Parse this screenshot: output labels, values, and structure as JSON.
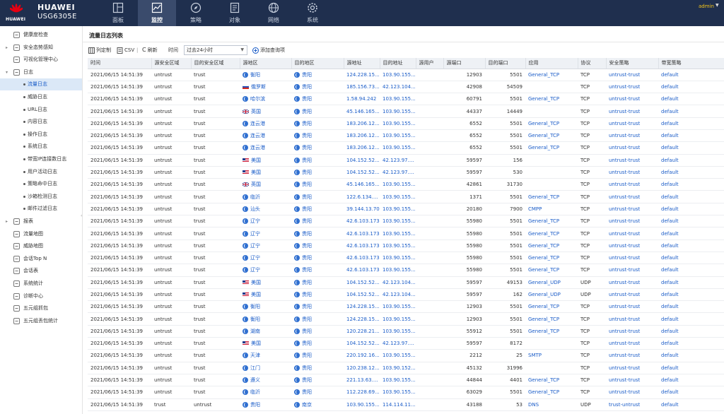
{
  "header": {
    "brand": "HUAWEI",
    "logo_text": "HUAWEI",
    "model": "USG6305E",
    "user": "admin",
    "nav": [
      {
        "label": "面板",
        "icon": "dashboard-icon",
        "active": false
      },
      {
        "label": "监控",
        "icon": "monitor-chart-icon",
        "active": true
      },
      {
        "label": "策略",
        "icon": "compass-icon",
        "active": false
      },
      {
        "label": "对象",
        "icon": "object-doc-icon",
        "active": false
      },
      {
        "label": "网络",
        "icon": "network-globe-icon",
        "active": false
      },
      {
        "label": "系统",
        "icon": "gear-icon",
        "active": false
      }
    ]
  },
  "sidebar": {
    "items": [
      {
        "label": "健康度检查",
        "icon": "heart-icon",
        "expand": ""
      },
      {
        "label": "安全态势感知",
        "icon": "shield-icon",
        "expand": "▸"
      },
      {
        "label": "可视化管理中心",
        "icon": "chart-icon",
        "expand": ""
      },
      {
        "label": "日志",
        "icon": "log-icon",
        "expand": "▾"
      },
      {
        "label": "流量日志",
        "sub": true,
        "active": true
      },
      {
        "label": "威胁日志",
        "sub": true
      },
      {
        "label": "URL日志",
        "sub": true
      },
      {
        "label": "内容日志",
        "sub": true
      },
      {
        "label": "操作日志",
        "sub": true
      },
      {
        "label": "系统日志",
        "sub": true
      },
      {
        "label": "带宽IP连接数日志",
        "sub": true
      },
      {
        "label": "用户活动日志",
        "sub": true
      },
      {
        "label": "策略命中日志",
        "sub": true
      },
      {
        "label": "沙箱检测日志",
        "sub": true
      },
      {
        "label": "邮件过滤日志",
        "sub": true
      },
      {
        "label": "报表",
        "icon": "report-icon",
        "expand": "▸"
      },
      {
        "label": "流量地图",
        "icon": "traffic-map-icon",
        "expand": ""
      },
      {
        "label": "威胁地图",
        "icon": "threat-map-icon",
        "expand": ""
      },
      {
        "label": "会话Top N",
        "icon": "session-icon",
        "expand": ""
      },
      {
        "label": "会话表",
        "icon": "session-table-icon",
        "expand": ""
      },
      {
        "label": "系统统计",
        "icon": "stats-icon",
        "expand": ""
      },
      {
        "label": "诊断中心",
        "icon": "diagnose-icon",
        "expand": ""
      },
      {
        "label": "五元组抓包",
        "icon": "capture-icon",
        "expand": ""
      },
      {
        "label": "五元组丢包统计",
        "icon": "drop-stats-icon",
        "expand": ""
      }
    ]
  },
  "main": {
    "title": "流量日志列表",
    "toolbar": {
      "customize": "列定制",
      "csv": "CSV",
      "refresh": "刷新",
      "time_label": "时间",
      "time_value": "过去24小时",
      "add_query": "添加查询项"
    },
    "columns": [
      "时间",
      "源安全区域",
      "目的安全区域",
      "源地区",
      "目的地区",
      "源地址",
      "目的地址",
      "源用户",
      "源端口",
      "目的端口",
      "应用",
      "协议",
      "安全策略",
      "带宽策略"
    ],
    "rows": [
      [
        "2021/06/15 14:51:39",
        "untrust",
        "trust",
        "衡阳",
        "globe",
        "贵阳",
        "124.228.15...",
        "103.90.155...",
        "",
        "12903",
        "5501",
        "General_TCP",
        "TCP",
        "untrust-trust",
        "default"
      ],
      [
        "2021/06/15 14:51:39",
        "untrust",
        "trust",
        "俄罗斯",
        "ru",
        "贵阳",
        "185.156.73...",
        "42.123.104...",
        "",
        "42908",
        "54509",
        "",
        "TCP",
        "untrust-trust",
        "default"
      ],
      [
        "2021/06/15 14:51:39",
        "untrust",
        "trust",
        "哈尔滨",
        "globe",
        "贵阳",
        "1.58.94.242",
        "103.90.155...",
        "",
        "60791",
        "5501",
        "General_TCP",
        "TCP",
        "untrust-trust",
        "default"
      ],
      [
        "2021/06/15 14:51:39",
        "untrust",
        "trust",
        "英国",
        "uk",
        "贵阳",
        "45.146.165...",
        "103.90.155...",
        "",
        "44337",
        "14449",
        "",
        "TCP",
        "untrust-trust",
        "default"
      ],
      [
        "2021/06/15 14:51:39",
        "untrust",
        "trust",
        "连云港",
        "globe",
        "贵阳",
        "183.206.12...",
        "103.90.155...",
        "",
        "6552",
        "5501",
        "General_TCP",
        "TCP",
        "untrust-trust",
        "default"
      ],
      [
        "2021/06/15 14:51:39",
        "untrust",
        "trust",
        "连云港",
        "globe",
        "贵阳",
        "183.206.12...",
        "103.90.155...",
        "",
        "6552",
        "5501",
        "General_TCP",
        "TCP",
        "untrust-trust",
        "default"
      ],
      [
        "2021/06/15 14:51:39",
        "untrust",
        "trust",
        "连云港",
        "globe",
        "贵阳",
        "183.206.12...",
        "103.90.155...",
        "",
        "6552",
        "5501",
        "General_TCP",
        "TCP",
        "untrust-trust",
        "default"
      ],
      [
        "2021/06/15 14:51:39",
        "untrust",
        "trust",
        "美国",
        "us",
        "贵阳",
        "104.152.52...",
        "42.123.97....",
        "",
        "59597",
        "156",
        "",
        "TCP",
        "untrust-trust",
        "default"
      ],
      [
        "2021/06/15 14:51:39",
        "untrust",
        "trust",
        "美国",
        "us",
        "贵阳",
        "104.152.52...",
        "42.123.97....",
        "",
        "59597",
        "530",
        "",
        "TCP",
        "untrust-trust",
        "default"
      ],
      [
        "2021/06/15 14:51:39",
        "untrust",
        "trust",
        "英国",
        "uk",
        "贵阳",
        "45.146.165...",
        "103.90.155...",
        "",
        "42861",
        "31730",
        "",
        "TCP",
        "untrust-trust",
        "default"
      ],
      [
        "2021/06/15 14:51:39",
        "untrust",
        "trust",
        "临沂",
        "globe",
        "贵阳",
        "122.6.134....",
        "103.90.155...",
        "",
        "1371",
        "5501",
        "General_TCP",
        "TCP",
        "untrust-trust",
        "default"
      ],
      [
        "2021/06/15 14:51:39",
        "untrust",
        "trust",
        "汕头",
        "globe",
        "贵阳",
        "39.144.13.70",
        "103.90.155...",
        "",
        "20180",
        "7900",
        "CMPP",
        "TCP",
        "untrust-trust",
        "default"
      ],
      [
        "2021/06/15 14:51:39",
        "untrust",
        "trust",
        "辽宁",
        "globe",
        "贵阳",
        "42.6.103.173",
        "103.90.155...",
        "",
        "55980",
        "5501",
        "General_TCP",
        "TCP",
        "untrust-trust",
        "default"
      ],
      [
        "2021/06/15 14:51:39",
        "untrust",
        "trust",
        "辽宁",
        "globe",
        "贵阳",
        "42.6.103.173",
        "103.90.155...",
        "",
        "55980",
        "5501",
        "General_TCP",
        "TCP",
        "untrust-trust",
        "default"
      ],
      [
        "2021/06/15 14:51:39",
        "untrust",
        "trust",
        "辽宁",
        "globe",
        "贵阳",
        "42.6.103.173",
        "103.90.155...",
        "",
        "55980",
        "5501",
        "General_TCP",
        "TCP",
        "untrust-trust",
        "default"
      ],
      [
        "2021/06/15 14:51:39",
        "untrust",
        "trust",
        "辽宁",
        "globe",
        "贵阳",
        "42.6.103.173",
        "103.90.155...",
        "",
        "55980",
        "5501",
        "General_TCP",
        "TCP",
        "untrust-trust",
        "default"
      ],
      [
        "2021/06/15 14:51:39",
        "untrust",
        "trust",
        "辽宁",
        "globe",
        "贵阳",
        "42.6.103.173",
        "103.90.155...",
        "",
        "55980",
        "5501",
        "General_TCP",
        "TCP",
        "untrust-trust",
        "default"
      ],
      [
        "2021/06/15 14:51:39",
        "untrust",
        "trust",
        "美国",
        "us",
        "贵阳",
        "104.152.52...",
        "42.123.104...",
        "",
        "59597",
        "49153",
        "General_UDP",
        "UDP",
        "untrust-trust",
        "default"
      ],
      [
        "2021/06/15 14:51:39",
        "untrust",
        "trust",
        "美国",
        "us",
        "贵阳",
        "104.152.52...",
        "42.123.104...",
        "",
        "59597",
        "162",
        "General_UDP",
        "UDP",
        "untrust-trust",
        "default"
      ],
      [
        "2021/06/15 14:51:39",
        "untrust",
        "trust",
        "衡阳",
        "globe",
        "贵阳",
        "124.228.15...",
        "103.90.155...",
        "",
        "12903",
        "5501",
        "General_TCP",
        "TCP",
        "untrust-trust",
        "default"
      ],
      [
        "2021/06/15 14:51:39",
        "untrust",
        "trust",
        "衡阳",
        "globe",
        "贵阳",
        "124.228.15...",
        "103.90.155...",
        "",
        "12903",
        "5501",
        "General_TCP",
        "TCP",
        "untrust-trust",
        "default"
      ],
      [
        "2021/06/15 14:51:39",
        "untrust",
        "trust",
        "湖南",
        "globe",
        "贵阳",
        "120.228.21...",
        "103.90.155...",
        "",
        "55912",
        "5501",
        "General_TCP",
        "TCP",
        "untrust-trust",
        "default"
      ],
      [
        "2021/06/15 14:51:39",
        "untrust",
        "trust",
        "美国",
        "us",
        "贵阳",
        "104.152.52...",
        "42.123.97....",
        "",
        "59597",
        "8172",
        "",
        "TCP",
        "untrust-trust",
        "default"
      ],
      [
        "2021/06/15 14:51:39",
        "untrust",
        "trust",
        "天津",
        "globe",
        "贵阳",
        "220.192.16...",
        "103.90.155...",
        "",
        "2212",
        "25",
        "SMTP",
        "TCP",
        "untrust-trust",
        "default"
      ],
      [
        "2021/06/15 14:51:39",
        "untrust",
        "trust",
        "江门",
        "globe",
        "贵阳",
        "120.238.12...",
        "103.90.152...",
        "",
        "45132",
        "31996",
        "",
        "TCP",
        "untrust-trust",
        "default"
      ],
      [
        "2021/06/15 14:51:39",
        "untrust",
        "trust",
        "遵义",
        "globe",
        "贵阳",
        "221.13.63....",
        "103.90.155...",
        "",
        "44844",
        "4401",
        "General_TCP",
        "TCP",
        "untrust-trust",
        "default"
      ],
      [
        "2021/06/15 14:51:39",
        "untrust",
        "trust",
        "临沂",
        "globe",
        "贵阳",
        "112.228.69....",
        "103.90.155...",
        "",
        "63029",
        "5501",
        "General_TCP",
        "TCP",
        "untrust-trust",
        "default"
      ],
      [
        "2021/06/15 14:51:39",
        "trust",
        "untrust",
        "贵阳",
        "globe",
        "南京",
        "103.90.155...",
        "114.114.11...",
        "",
        "43188",
        "53",
        "DNS",
        "UDP",
        "trust-untrust",
        "default"
      ]
    ]
  },
  "colors": {
    "topbar": "#1f2f4e",
    "nav_active": "#3a4b6c",
    "link": "#1a5cc8",
    "admin": "#f5c518",
    "sidebar_active": "#dbe8f7"
  }
}
